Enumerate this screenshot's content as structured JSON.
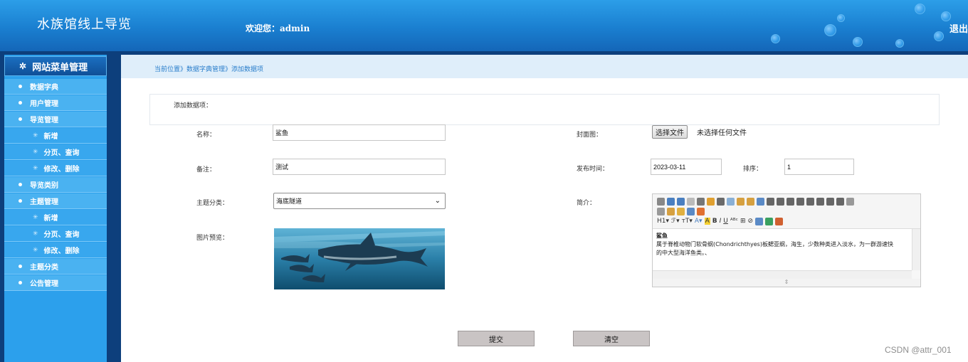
{
  "header": {
    "title": "水族馆线上导览",
    "welcome_prefix": "欢迎您：",
    "username": "admin",
    "logout_label": "退出"
  },
  "sidebar": {
    "title": "网站菜单管理",
    "items": [
      {
        "label": "数据字典",
        "level": 1
      },
      {
        "label": "用户管理",
        "level": 1
      },
      {
        "label": "导览管理",
        "level": 1
      },
      {
        "label": "新增",
        "level": 2
      },
      {
        "label": "分页、查询",
        "level": 2
      },
      {
        "label": "修改、删除",
        "level": 2
      },
      {
        "label": "导览类别",
        "level": 1
      },
      {
        "label": "主题管理",
        "level": 1
      },
      {
        "label": "新增",
        "level": 2
      },
      {
        "label": "分页、查询",
        "level": 2
      },
      {
        "label": "修改、删除",
        "level": 2
      },
      {
        "label": "主题分类",
        "level": 1
      },
      {
        "label": "公告管理",
        "level": 1
      }
    ]
  },
  "breadcrumb": "当前位置》数据字典管理》添加数据项",
  "form": {
    "section_title": "添加数据项：",
    "name_label": "名称：",
    "name_value": "鲨鱼",
    "cover_label": "封面图：",
    "file_button": "选择文件",
    "file_status": "未选择任何文件",
    "note_label": "备注：",
    "note_value": "测试",
    "publish_label": "发布时间：",
    "publish_value": "2023-03-11",
    "order_label": "排序：",
    "order_value": "1",
    "category_label": "主题分类：",
    "category_value": "海底隧道",
    "intro_label": "简介：",
    "preview_label": "图片预览：",
    "editor_title": "鲨鱼",
    "editor_line1": "属于脊椎动物门软骨纲(Chondrichthyes)板鳃亚纲，海生，少数种类进入淡水，为一群游速快",
    "editor_line2": "的中大型海洋鱼类。、",
    "submit_label": "提交",
    "clear_label": "清空"
  },
  "watermark": "CSDN @attr_001",
  "colors": {
    "header_blue": "#1a7fd0",
    "sidebar_dark": "#0d3f7c",
    "sidebar_item": "#4ab2f1",
    "crumb_text": "#2a7ecb"
  }
}
